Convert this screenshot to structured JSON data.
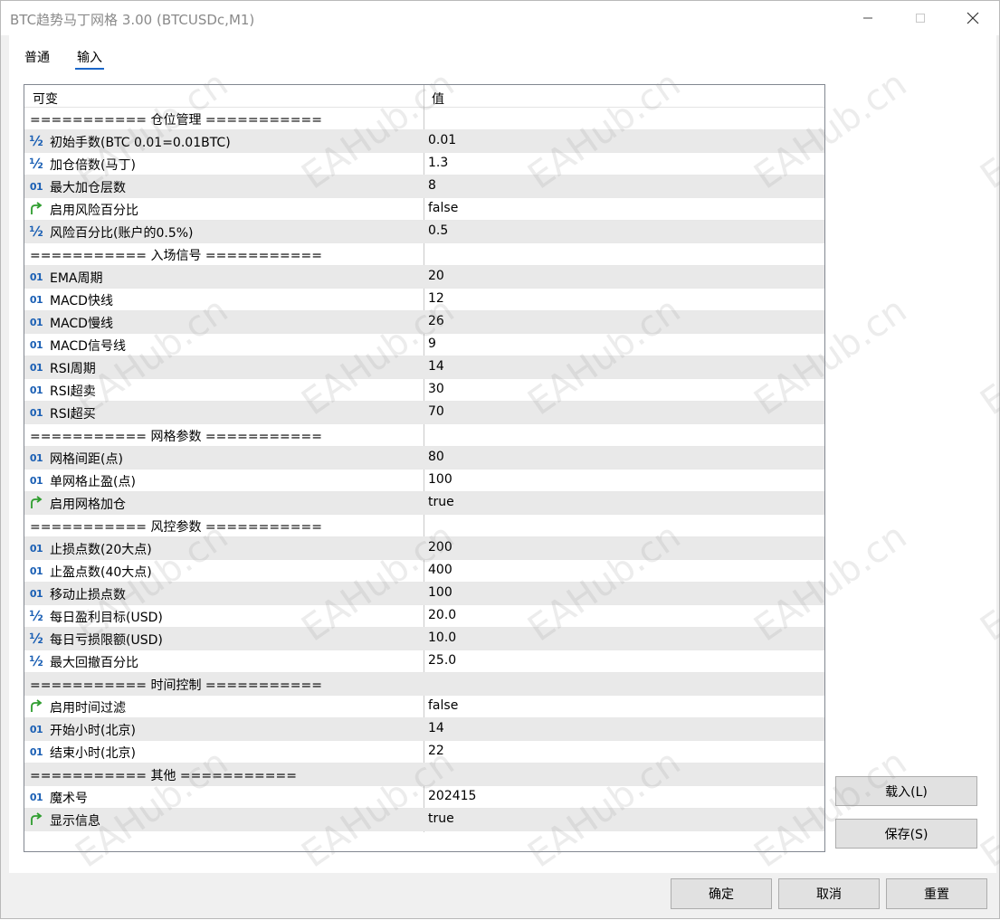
{
  "window": {
    "title": "BTC趋势马丁网格 3.00 (BTCUSDc,M1)"
  },
  "tabs": [
    {
      "label": "普通"
    },
    {
      "label": "输入"
    }
  ],
  "grid": {
    "headers": {
      "name": "可变",
      "value": "值"
    },
    "rows": [
      {
        "type": "section",
        "name": "=========== 仓位管理 ===========",
        "value": ""
      },
      {
        "type": "double",
        "icon": "double-type-icon",
        "name": "初始手数(BTC 0.01=0.01BTC)",
        "value": "0.01"
      },
      {
        "type": "double",
        "icon": "double-type-icon",
        "name": "加仓倍数(马丁)",
        "value": "1.3"
      },
      {
        "type": "int",
        "icon": "int-type-icon",
        "name": "最大加仓层数",
        "value": "8"
      },
      {
        "type": "bool",
        "icon": "bool-type-icon",
        "name": "启用风险百分比",
        "value": "false"
      },
      {
        "type": "double",
        "icon": "double-type-icon",
        "name": "风险百分比(账户的0.5%)",
        "value": "0.5"
      },
      {
        "type": "section",
        "name": "=========== 入场信号 ===========",
        "value": ""
      },
      {
        "type": "int",
        "icon": "int-type-icon",
        "name": "EMA周期",
        "value": "20"
      },
      {
        "type": "int",
        "icon": "int-type-icon",
        "name": "MACD快线",
        "value": "12"
      },
      {
        "type": "int",
        "icon": "int-type-icon",
        "name": "MACD慢线",
        "value": "26"
      },
      {
        "type": "int",
        "icon": "int-type-icon",
        "name": "MACD信号线",
        "value": "9"
      },
      {
        "type": "int",
        "icon": "int-type-icon",
        "name": "RSI周期",
        "value": "14"
      },
      {
        "type": "int",
        "icon": "int-type-icon",
        "name": "RSI超卖",
        "value": "30"
      },
      {
        "type": "int",
        "icon": "int-type-icon",
        "name": "RSI超买",
        "value": "70"
      },
      {
        "type": "section",
        "name": "=========== 网格参数 ===========",
        "value": ""
      },
      {
        "type": "int",
        "icon": "int-type-icon",
        "name": "网格间距(点)",
        "value": "80"
      },
      {
        "type": "int",
        "icon": "int-type-icon",
        "name": "单网格止盈(点)",
        "value": "100"
      },
      {
        "type": "bool",
        "icon": "bool-type-icon",
        "name": "启用网格加仓",
        "value": "true"
      },
      {
        "type": "section",
        "name": "=========== 风控参数 ===========",
        "value": ""
      },
      {
        "type": "int",
        "icon": "int-type-icon",
        "name": "止损点数(20大点)",
        "value": "200"
      },
      {
        "type": "int",
        "icon": "int-type-icon",
        "name": "止盈点数(40大点)",
        "value": "400"
      },
      {
        "type": "int",
        "icon": "int-type-icon",
        "name": "移动止损点数",
        "value": "100"
      },
      {
        "type": "double",
        "icon": "double-type-icon",
        "name": "每日盈利目标(USD)",
        "value": "20.0"
      },
      {
        "type": "double",
        "icon": "double-type-icon",
        "name": "每日亏损限额(USD)",
        "value": "10.0"
      },
      {
        "type": "double",
        "icon": "double-type-icon",
        "name": "最大回撤百分比",
        "value": "25.0"
      },
      {
        "type": "section",
        "name": "=========== 时间控制 ===========",
        "value": ""
      },
      {
        "type": "bool",
        "icon": "bool-type-icon",
        "name": "启用时间过滤",
        "value": "false"
      },
      {
        "type": "int",
        "icon": "int-type-icon",
        "name": "开始小时(北京)",
        "value": "14"
      },
      {
        "type": "int",
        "icon": "int-type-icon",
        "name": "结束小时(北京)",
        "value": "22"
      },
      {
        "type": "section",
        "name": "=========== 其他 ===========",
        "value": ""
      },
      {
        "type": "int",
        "icon": "int-type-icon",
        "name": "魔术号",
        "value": "202415"
      },
      {
        "type": "bool",
        "icon": "bool-type-icon",
        "name": "显示信息",
        "value": "true"
      }
    ]
  },
  "buttons": {
    "load": "载入(L)",
    "save": "保存(S)",
    "ok": "确定",
    "cancel": "取消",
    "reset": "重置"
  },
  "watermark": "EAHub.cn",
  "icons": {
    "int": "01",
    "double": "½"
  },
  "colors": {
    "int_icon": "#1a5fb4",
    "bool_icon": "#2e9d2e",
    "tab_underline": "#1a66c9",
    "alt_row": "#e9e9e9"
  }
}
